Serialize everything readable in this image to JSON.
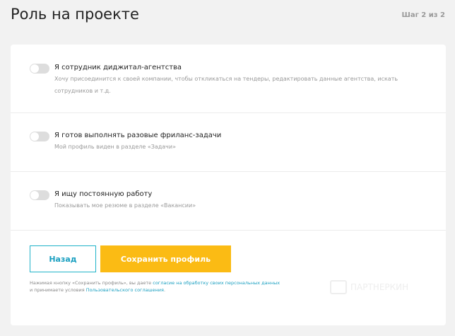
{
  "header": {
    "title": "Роль на проекте",
    "step": "Шаг 2 из 2"
  },
  "options": [
    {
      "label": "Я сотрудник диджитал-агентства",
      "desc": "Хочу присоединится к своей компании, чтобы откликаться на тендеры, редактировать данные агентства, искать сотрудников и т.д.",
      "enabled": false
    },
    {
      "label": "Я готов выполнять разовые фриланс-задачи",
      "desc": "Мой профиль виден в разделе «Задачи»",
      "enabled": false
    },
    {
      "label": "Я ищу постоянную работу",
      "desc": "Показывать мое резюме в разделе «Вакансии»",
      "enabled": false
    }
  ],
  "buttons": {
    "back": "Назад",
    "save": "Сохранить профиль"
  },
  "note": {
    "prefix": "Нажимая кнопку «Сохранить профиль», вы даете ",
    "link1": "согласие на обработку своих персональных данных",
    "middle": " и принимаете условия ",
    "link2": "Пользовательского соглашения",
    "suffix": "."
  },
  "watermark": "ПАРТНЕРКИН"
}
